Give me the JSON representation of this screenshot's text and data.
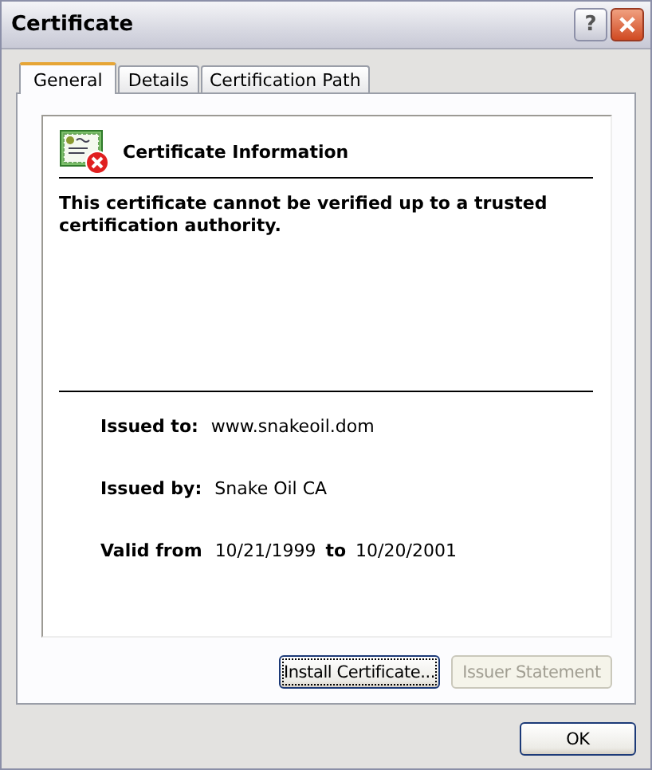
{
  "window": {
    "title": "Certificate",
    "help_button": "?"
  },
  "tabs": [
    {
      "label": "General",
      "selected": true
    },
    {
      "label": "Details",
      "selected": false
    },
    {
      "label": "Certification Path",
      "selected": false
    }
  ],
  "info": {
    "heading": "Certificate Information",
    "message": "This certificate cannot be verified up to a trusted certification authority."
  },
  "fields": [
    {
      "label": "Issued to:",
      "value": "www.snakeoil.dom"
    },
    {
      "label": "Issued by:",
      "value": "Snake Oil CA"
    }
  ],
  "validity": {
    "label": "Valid from",
    "from": "10/21/1999",
    "to_label": "to",
    "to": "10/20/2001"
  },
  "panel_buttons": [
    {
      "label": "Install Certificate...",
      "disabled": false,
      "focused": true
    },
    {
      "label": "Issuer Statement",
      "disabled": true,
      "focused": false
    }
  ],
  "dialog_buttons": [
    {
      "label": "OK",
      "disabled": false
    }
  ]
}
